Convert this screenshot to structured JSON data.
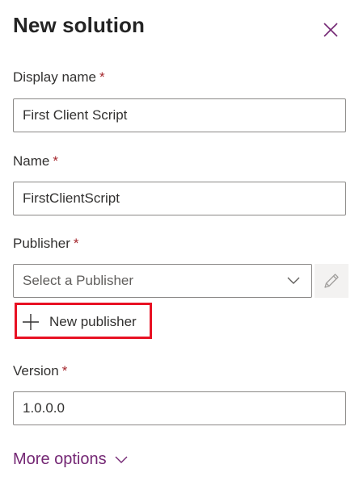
{
  "dialog": {
    "title": "New solution",
    "close_icon": "close-icon"
  },
  "fields": {
    "display_name": {
      "label": "Display name",
      "required_marker": "*",
      "value": "First Client Script"
    },
    "name": {
      "label": "Name",
      "required_marker": "*",
      "value": "FirstClientScript"
    },
    "publisher": {
      "label": "Publisher",
      "required_marker": "*",
      "placeholder": "Select a Publisher",
      "dropdown_icon": "chevron-down-icon",
      "edit_icon": "pencil-icon",
      "new_publisher_label": "New publisher",
      "new_publisher_icon": "plus-icon"
    },
    "version": {
      "label": "Version",
      "required_marker": "*",
      "value": "1.0.0.0"
    }
  },
  "more_options": {
    "label": "More options",
    "icon": "chevron-down-icon"
  },
  "colors": {
    "required": "#a4262c",
    "link_purple": "#742774",
    "highlight_box": "#e81123",
    "close_icon": "#742774"
  }
}
